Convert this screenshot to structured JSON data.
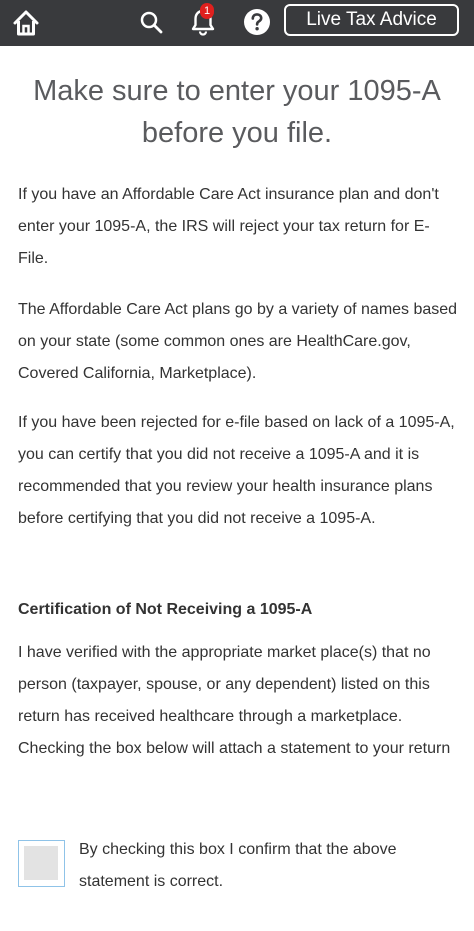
{
  "topbar": {
    "icons": {
      "home": "home-icon",
      "search": "search-icon",
      "bell": "bell-icon",
      "help": "help-icon"
    },
    "notification_count": "1",
    "live_advice_label": "Live Tax Advice",
    "colors": {
      "bar_background": "#393a3d",
      "badge": "#e0201e"
    }
  },
  "main": {
    "headline": "Make sure to enter your 1095-A before you file.",
    "paragraphs": [
      "If you have an Affordable Care Act insurance plan and don't enter your 1095-A, the IRS will reject your tax return for E-File.",
      "The Affordable Care Act plans go by a variety of names based on your state (some common ones are HealthCare.gov, Covered California, Marketplace).",
      "If you have been rejected for e-file based on lack of a 1095-A, you can certify that you did not receive a 1095-A and it is recommended that you review your health insurance plans before certifying that you did not receive a 1095-A."
    ],
    "certification": {
      "heading": "Certification of Not Receiving a 1095-A",
      "statement": "I have verified with the appropriate market place(s) that no person (taxpayer, spouse, or any dependent) listed on this return has received healthcare through a marketplace. Checking the box below will attach a statement to your return",
      "checkbox_checked": false,
      "checkbox_label": "By checking this box I confirm that the above statement is correct."
    }
  }
}
